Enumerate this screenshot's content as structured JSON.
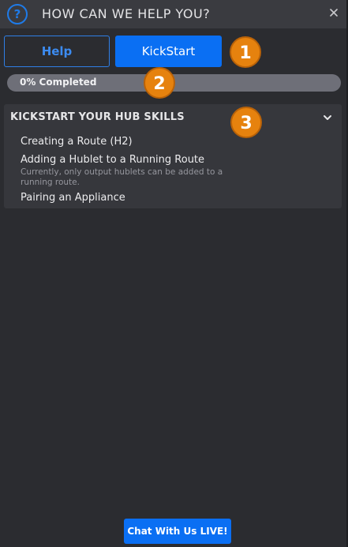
{
  "header": {
    "title": "HOW CAN WE HELP YOU?",
    "help_icon_glyph": "?",
    "close_icon": "close-icon"
  },
  "tabs": {
    "help_label": "Help",
    "kickstart_label": "KickStart",
    "active": "KickStart"
  },
  "progress": {
    "label": "0% Completed",
    "percent": 0
  },
  "callouts": [
    "1",
    "2",
    "3"
  ],
  "section": {
    "title": "KICKSTART YOUR HUB SKILLS",
    "expanded": true,
    "items": [
      {
        "label": "Creating a Route (H2)"
      },
      {
        "label": "Adding a Hublet to a Running Route",
        "description": "Currently, only output hublets can be added to a running route."
      },
      {
        "label": "Pairing an Appliance"
      }
    ]
  },
  "footer": {
    "chat_label": "Chat With Us LIVE!"
  },
  "colors": {
    "accent": "#0a6ff3",
    "callout": "#e6820e",
    "background": "#2b2c30"
  }
}
